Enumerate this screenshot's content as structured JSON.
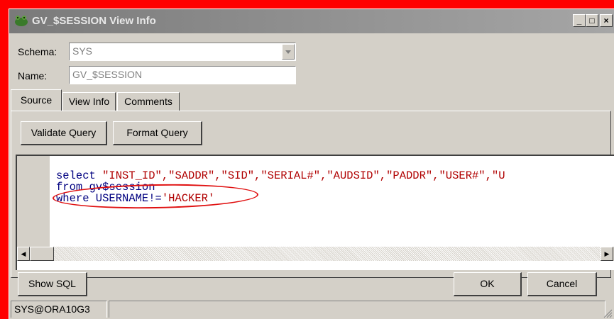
{
  "window": {
    "title": "GV_$SESSION View Info",
    "minimize_label": "_",
    "maximize_label": "□",
    "close_label": "×"
  },
  "form": {
    "schema_label": "Schema:",
    "schema_value": "SYS",
    "name_label": "Name:",
    "name_value": "GV_$SESSION"
  },
  "tabs": [
    {
      "label": "Source",
      "active": true
    },
    {
      "label": "View Info",
      "active": false
    },
    {
      "label": "Comments",
      "active": false
    }
  ],
  "toolbar": {
    "validate_label": "Validate Query",
    "format_label": "Format Query"
  },
  "editor": {
    "line1_kw": "select ",
    "line1_str": "\"INST_ID\",\"SADDR\",\"SID\",\"SERIAL#\",\"AUDSID\",\"PADDR\",\"USER#\",\"U",
    "line2": "from gv$session",
    "line3_kw": "where USERNAME!=",
    "line3_str": "'HACKER'"
  },
  "footer": {
    "show_sql_label": "Show SQL",
    "ok_label": "OK",
    "cancel_label": "Cancel"
  },
  "status": {
    "connection": "SYS@ORA10G3"
  },
  "colors": {
    "keyword": "#000080",
    "string": "#b00000",
    "highlight_circle": "#e01010"
  }
}
